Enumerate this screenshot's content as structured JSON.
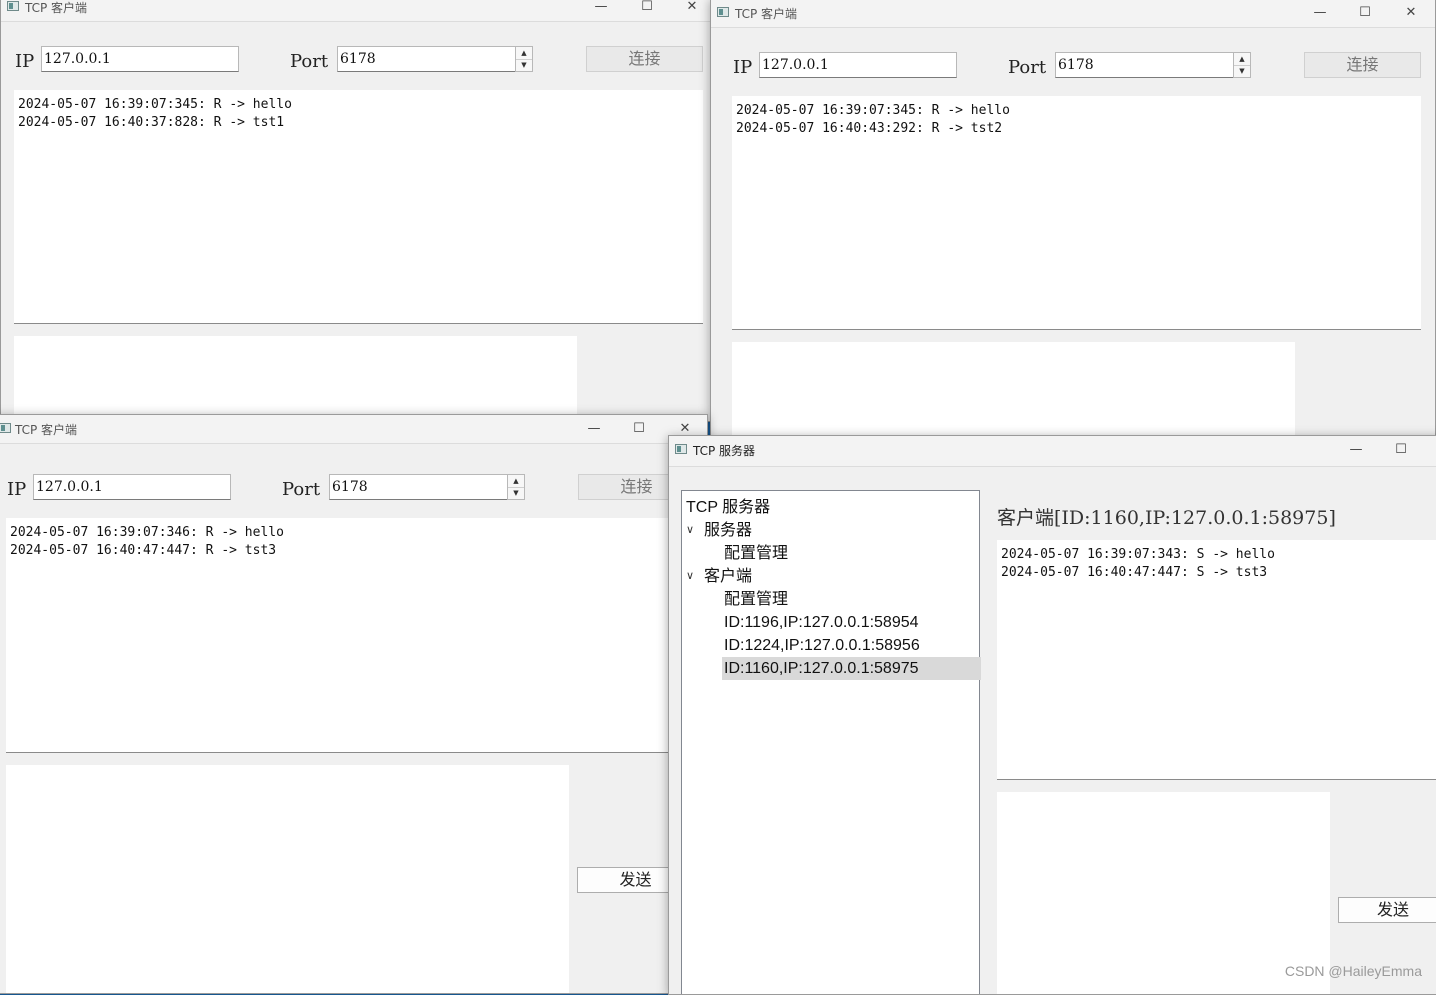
{
  "client1": {
    "title": "TCP 客户端",
    "ip_label": "IP",
    "ip_value": "127.0.0.1",
    "port_label": "Port",
    "port_value": "6178",
    "connect_label": "连接",
    "log": [
      "2024-05-07 16:39:07:345: R -> hello",
      "2024-05-07 16:40:37:828: R -> tst1"
    ]
  },
  "client2": {
    "title": "TCP 客户端",
    "ip_label": "IP",
    "ip_value": "127.0.0.1",
    "port_label": "Port",
    "port_value": "6178",
    "connect_label": "连接",
    "log": [
      "2024-05-07 16:39:07:345: R -> hello",
      "2024-05-07 16:40:43:292: R -> tst2"
    ]
  },
  "client3": {
    "title": "TCP 客户端",
    "ip_label": "IP",
    "ip_value": "127.0.0.1",
    "port_label": "Port",
    "port_value": "6178",
    "connect_label": "连接",
    "log": [
      "2024-05-07 16:39:07:346: R -> hello",
      "2024-05-07 16:40:47:447: R -> tst3"
    ],
    "send_label": "发送"
  },
  "server": {
    "title": "TCP 服务器",
    "tree": {
      "root": "TCP 服务器",
      "server_node": "服务器",
      "server_config": "配置管理",
      "client_node": "客户端",
      "client_config": "配置管理",
      "clients": [
        "ID:1196,IP:127.0.0.1:58954",
        "ID:1224,IP:127.0.0.1:58956",
        "ID:1160,IP:127.0.0.1:58975"
      ]
    },
    "selected_client_header": "客户端[ID:1160,IP:127.0.0.1:58975]",
    "log": [
      "2024-05-07 16:39:07:343: S -> hello",
      "2024-05-07 16:40:47:447: S -> tst3"
    ],
    "send_label": "发送"
  },
  "window_controls": {
    "minimize": "—",
    "maximize": "☐",
    "close": "✕"
  },
  "watermark": "CSDN @HaileyEmma"
}
